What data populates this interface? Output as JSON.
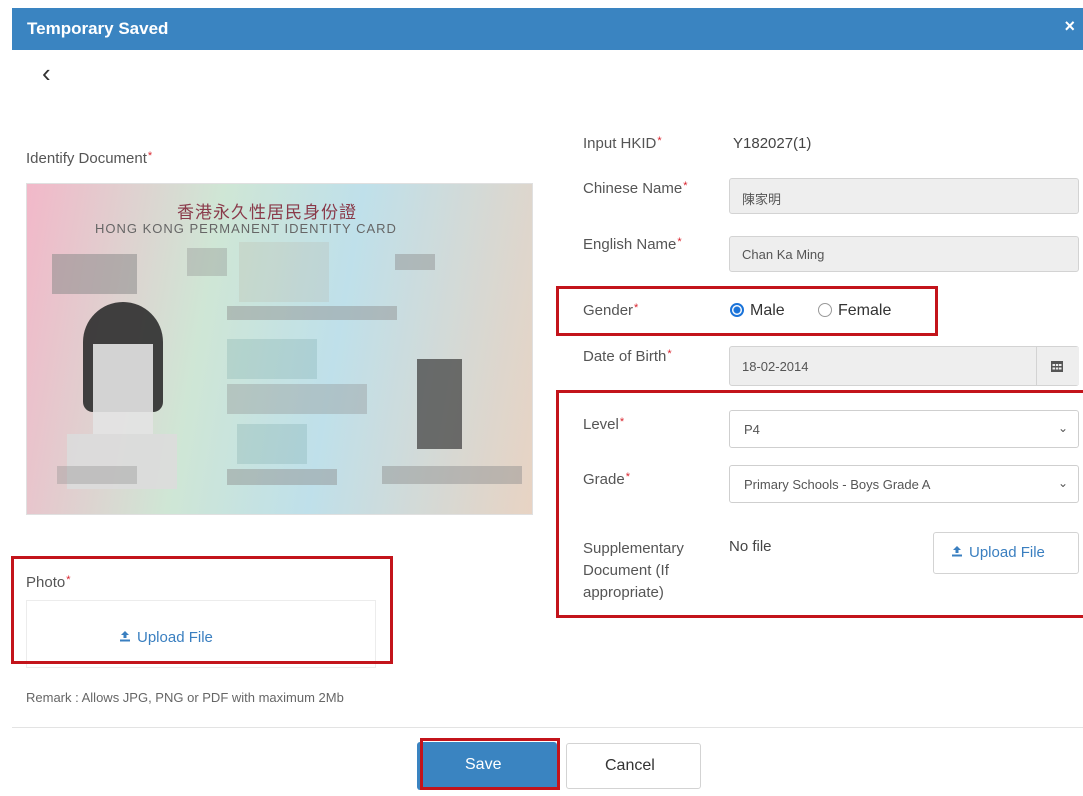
{
  "modal": {
    "title": "Temporary Saved",
    "close_glyph": "×",
    "back_glyph": "‹"
  },
  "left": {
    "identify_label": "Identify Document",
    "card": {
      "chinese_title": "香港永久性居民身份證",
      "english_title": "HONG KONG PERMANENT IDENTITY CARD"
    },
    "photo_label": "Photo",
    "photo_upload": "Upload File",
    "remark": "Remark : Allows JPG, PNG or PDF with maximum 2Mb"
  },
  "form": {
    "hkid_label": "Input HKID",
    "hkid_value": "Y182027(1)",
    "chinese_name_label": "Chinese Name",
    "chinese_name_value": "陳家明",
    "english_name_label": "English Name",
    "english_name_value": "Chan Ka Ming",
    "gender_label": "Gender",
    "gender_options": [
      "Male",
      "Female"
    ],
    "gender_selected": "Male",
    "dob_label": "Date of Birth",
    "dob_value": "18-02-2014",
    "level_label": "Level",
    "level_value": "P4",
    "grade_label": "Grade",
    "grade_value": "Primary Schools - Boys Grade A",
    "supp_label_line1": "Supplementary",
    "supp_label_line2": "Document (If",
    "supp_label_line3": "appropriate)",
    "supp_value": "No file",
    "supp_upload": "Upload File"
  },
  "footer": {
    "save": "Save",
    "cancel": "Cancel"
  },
  "colors": {
    "titlebar": "#3a84c1",
    "primary": "#3a84c1",
    "highlight": "#c3141b",
    "required": "#d9232d"
  },
  "icons": {
    "calendar": "calendar-icon",
    "upload": "upload-icon",
    "chevron": "chevron-down-icon"
  }
}
